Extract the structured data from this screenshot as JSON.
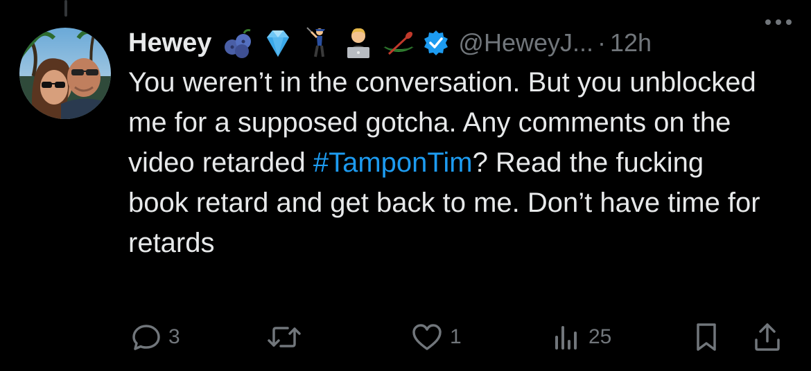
{
  "user": {
    "display_name": "Hewey",
    "handle": "@HeweyJ...",
    "separator": "·",
    "time": "12h",
    "badges": [
      "blueberries-emoji",
      "gem-emoji",
      "golfer-emoji",
      "technologist-emoji",
      "canoe-emoji",
      "verified-badge-icon"
    ]
  },
  "tweet": {
    "text_before_hashtag": "You weren’t in the conversation. But you unblocked me for a supposed gotcha. Any comments on the video retarded ",
    "hashtag": "#TamponTim",
    "text_after_hashtag": "?  Read the fucking book retard and get back to me. Don’t have time for retards"
  },
  "actions": {
    "replies": "3",
    "reposts": "",
    "likes": "1",
    "views": "25"
  },
  "colors": {
    "background": "#000000",
    "text": "#e7e9ea",
    "muted": "#71767b",
    "link": "#1d9bf0",
    "verified": "#1d9bf0"
  }
}
